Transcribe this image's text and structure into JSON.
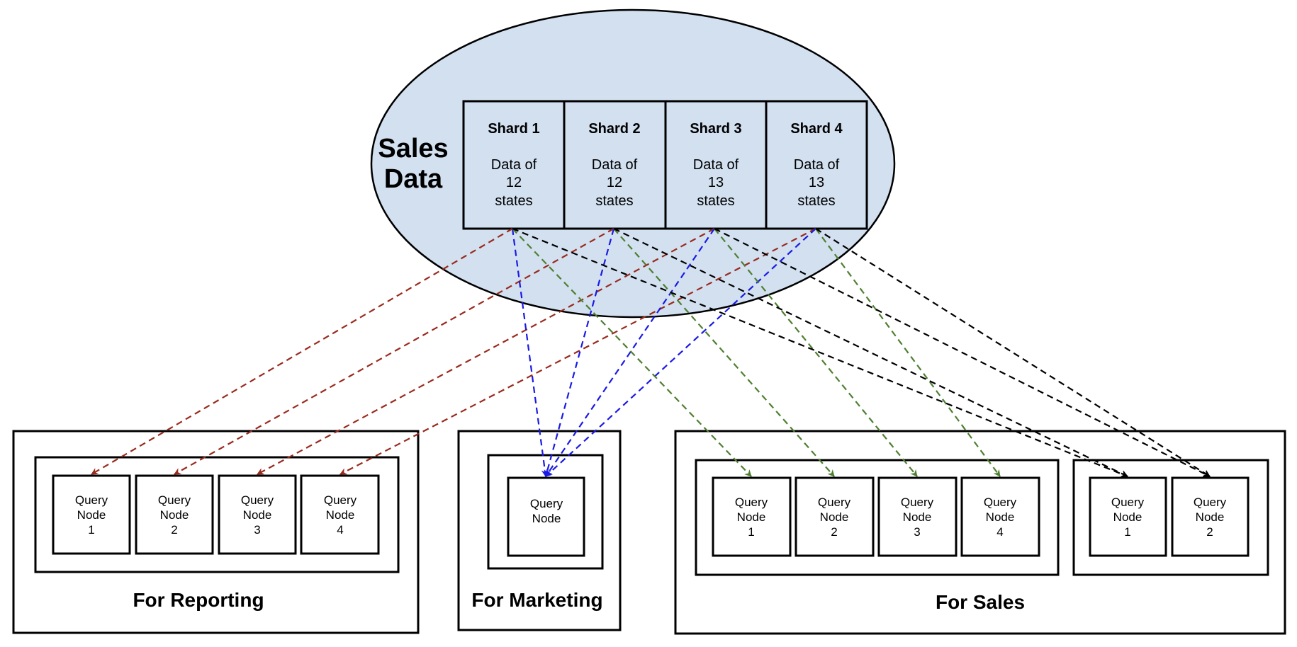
{
  "source": {
    "title_lines": [
      "Sales",
      "Data"
    ],
    "fill_color": "#d2e0f0",
    "shards": [
      {
        "title": "Shard 1",
        "lines": [
          "Data of",
          "12",
          "states"
        ]
      },
      {
        "title": "Shard 2",
        "lines": [
          "Data of",
          "12",
          "states"
        ]
      },
      {
        "title": "Shard 3",
        "lines": [
          "Data of",
          "13",
          "states"
        ]
      },
      {
        "title": "Shard 4",
        "lines": [
          "Data of",
          "13",
          "states"
        ]
      }
    ]
  },
  "groups": {
    "reporting": {
      "label": "For Reporting",
      "nodes": [
        {
          "lines": [
            "Query",
            "Node",
            "1"
          ]
        },
        {
          "lines": [
            "Query",
            "Node",
            "2"
          ]
        },
        {
          "lines": [
            "Query",
            "Node",
            "3"
          ]
        },
        {
          "lines": [
            "Query",
            "Node",
            "4"
          ]
        }
      ]
    },
    "marketing": {
      "label": "For Marketing",
      "nodes": [
        {
          "lines": [
            "Query",
            "Node"
          ]
        }
      ]
    },
    "sales": {
      "label": "For Sales",
      "cluster_a": [
        {
          "lines": [
            "Query",
            "Node",
            "1"
          ]
        },
        {
          "lines": [
            "Query",
            "Node",
            "2"
          ]
        },
        {
          "lines": [
            "Query",
            "Node",
            "3"
          ]
        },
        {
          "lines": [
            "Query",
            "Node",
            "4"
          ]
        }
      ],
      "cluster_b": [
        {
          "lines": [
            "Query",
            "Node",
            "1"
          ]
        },
        {
          "lines": [
            "Query",
            "Node",
            "2"
          ]
        }
      ]
    }
  },
  "edge_colors": {
    "reporting": "#9a2a1e",
    "marketing": "#1a1ae6",
    "sales_a": "#4e7f30",
    "sales_b": "#000000"
  },
  "edges": [
    {
      "from": "Shard 1",
      "to": "reporting.1",
      "color": "reporting"
    },
    {
      "from": "Shard 2",
      "to": "reporting.2",
      "color": "reporting"
    },
    {
      "from": "Shard 3",
      "to": "reporting.3",
      "color": "reporting"
    },
    {
      "from": "Shard 4",
      "to": "reporting.4",
      "color": "reporting"
    },
    {
      "from": "Shard 1",
      "to": "marketing.1",
      "color": "marketing"
    },
    {
      "from": "Shard 2",
      "to": "marketing.1",
      "color": "marketing"
    },
    {
      "from": "Shard 3",
      "to": "marketing.1",
      "color": "marketing"
    },
    {
      "from": "Shard 4",
      "to": "marketing.1",
      "color": "marketing"
    },
    {
      "from": "Shard 1",
      "to": "sales_a.1",
      "color": "sales_a"
    },
    {
      "from": "Shard 2",
      "to": "sales_a.2",
      "color": "sales_a"
    },
    {
      "from": "Shard 3",
      "to": "sales_a.3",
      "color": "sales_a"
    },
    {
      "from": "Shard 4",
      "to": "sales_a.4",
      "color": "sales_a"
    },
    {
      "from": "Shard 1",
      "to": "sales_b.1",
      "color": "sales_b"
    },
    {
      "from": "Shard 2",
      "to": "sales_b.1",
      "color": "sales_b"
    },
    {
      "from": "Shard 3",
      "to": "sales_b.2",
      "color": "sales_b"
    },
    {
      "from": "Shard 4",
      "to": "sales_b.2",
      "color": "sales_b"
    }
  ]
}
